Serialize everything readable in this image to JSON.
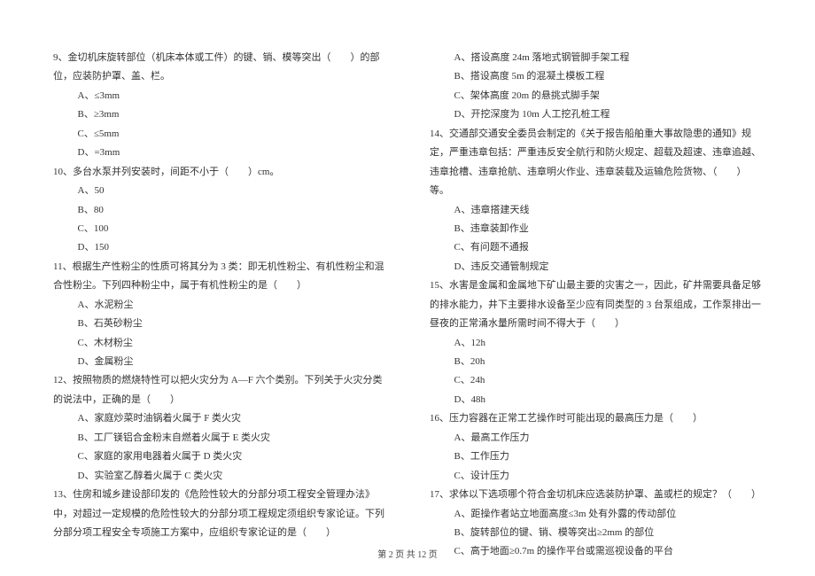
{
  "left": {
    "q9": {
      "stem": "9、金切机床旋转部位（机床本体或工件）的键、销、模等突出（　　）的部位，应装防护罩、盖、栏。",
      "a": "A、≤3mm",
      "b": "B、≥3mm",
      "c": "C、≤5mm",
      "d": "D、=3mm"
    },
    "q10": {
      "stem": "10、多台水泵并列安装时，间距不小于（　　）cm。",
      "a": "A、50",
      "b": "B、80",
      "c": "C、100",
      "d": "D、150"
    },
    "q11": {
      "stem": "11、根据生产性粉尘的性质可将其分为 3 类：即无机性粉尘、有机性粉尘和混合性粉尘。下列四种粉尘中，属于有机性粉尘的是（　　）",
      "a": "A、水泥粉尘",
      "b": "B、石英砂粉尘",
      "c": "C、木材粉尘",
      "d": "D、金属粉尘"
    },
    "q12": {
      "stem": "12、按照物质的燃烧特性可以把火灾分为 A—F 六个类别。下列关于火灾分类的说法中，正确的是（　　）",
      "a": "A、家庭炒菜时油锅着火属于 F 类火灾",
      "b": "B、工厂镁铝合金粉末自燃着火属于 E 类火灾",
      "c": "C、家庭的家用电器着火属于 D 类火灾",
      "d": "D、实验室乙醇着火属于 C 类火灾"
    },
    "q13": {
      "stem": "13、住房和城乡建设部印发的《危险性较大的分部分项工程安全管理办法》中，对超过一定规模的危险性较大的分部分项工程规定须组织专家论证。下列分部分项工程安全专项施工方案中，应组织专家论证的是（　　）"
    }
  },
  "right": {
    "q13opts": {
      "a": "A、搭设高度 24m 落地式钢管脚手架工程",
      "b": "B、搭设高度 5m 的混凝土模板工程",
      "c": "C、架体高度 20m 的悬挑式脚手架",
      "d": "D、开挖深度为 10m 人工挖孔桩工程"
    },
    "q14": {
      "stem": "14、交通部交通安全委员会制定的《关于报告船舶重大事故隐患的通知》规定，严重违章包括：严重违反安全航行和防火规定、超载及超速、违章追越、违章抢槽、违章抢航、违章明火作业、违章装载及运输危险货物、（　　）等。",
      "a": "A、违章搭建天线",
      "b": "B、违章装卸作业",
      "c": "C、有问题不通报",
      "d": "D、违反交通管制规定"
    },
    "q15": {
      "stem": "15、水害是金属和金属地下矿山最主要的灾害之一，因此，矿井需要具备足够的排水能力，井下主要排水设备至少应有同类型的 3 台泵组成，工作泵排出一昼夜的正常涌水量所需时间不得大于（　　）",
      "a": "A、12h",
      "b": "B、20h",
      "c": "C、24h",
      "d": "D、48h"
    },
    "q16": {
      "stem": "16、压力容器在正常工艺操作时可能出现的最高压力是（　　）",
      "a": "A、最高工作压力",
      "b": "B、工作压力",
      "c": "C、设计压力"
    },
    "q17": {
      "stem": "17、求体以下选项哪个符合金切机床应选装防护罩、盖或栏的规定？（　　）",
      "a": "A、距操作者站立地面高度≤3m 处有外露的传动部位",
      "b": "B、旋转部位的键、销、模等突出≥2mm 的部位",
      "c": "C、高于地面≥0.7m 的操作平台或需巡视设备的平台"
    }
  },
  "footer": "第 2 页 共 12 页"
}
